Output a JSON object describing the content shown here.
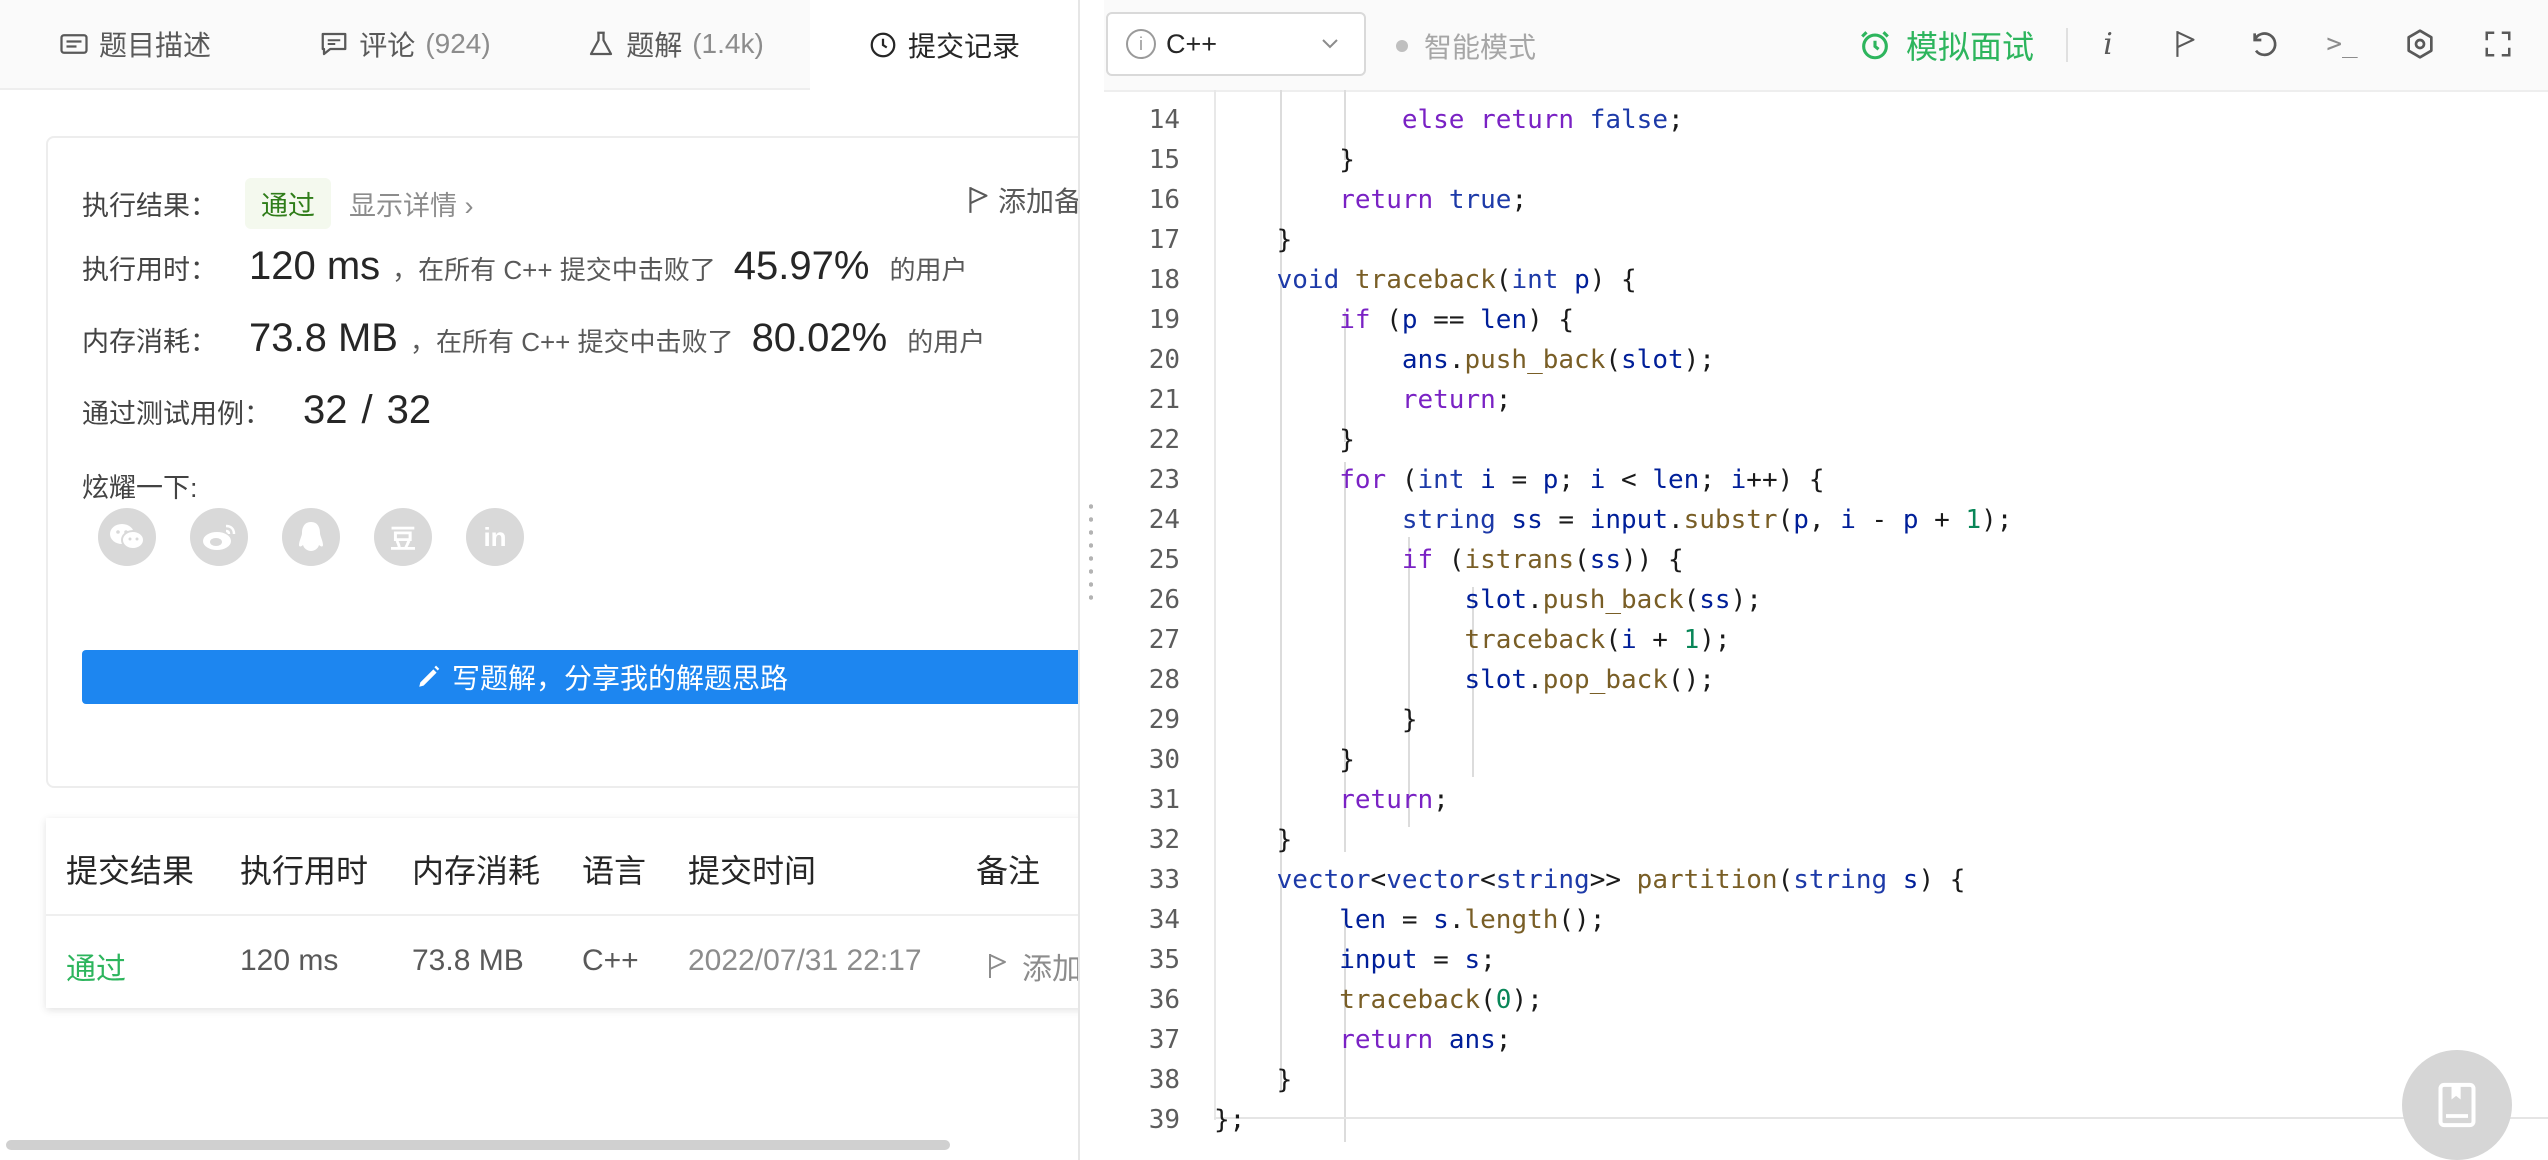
{
  "tabs": [
    {
      "label": "题目描述",
      "count": ""
    },
    {
      "label": "评论",
      "count": "(924)"
    },
    {
      "label": "题解",
      "count": "(1.4k)"
    },
    {
      "label": "提交记录",
      "count": ""
    }
  ],
  "result": {
    "exec_result_label": "执行结果：",
    "status": "通过",
    "details_link": "显示详情",
    "add_note": "添加备",
    "time_label": "执行用时：",
    "time_value": "120 ms",
    "time_mid": "，在所有 C++ 提交中击败了",
    "time_pct": "45.97%",
    "users_suffix": "的用户",
    "mem_label": "内存消耗：",
    "mem_value": "73.8 MB",
    "mem_mid": "，在所有 C++ 提交中击败了",
    "mem_pct": "80.02%",
    "tests_label": "通过测试用例：",
    "tests_value": "32",
    "tests_sep": "/",
    "tests_total": "32",
    "share_label": "炫耀一下:",
    "share_icons": [
      "wechat-icon",
      "weibo-icon",
      "qq-icon",
      "douban-icon",
      "linkedin-icon"
    ],
    "douban_glyph": "豆",
    "linkedin_glyph": "in",
    "write_solution": "写题解，分享我的解题思路"
  },
  "submissions": {
    "headers": [
      "提交结果",
      "执行用时",
      "内存消耗",
      "语言",
      "提交时间",
      "备注"
    ],
    "rows": [
      {
        "result": "通过",
        "time": "120 ms",
        "memory": "73.8 MB",
        "lang": "C++",
        "submitted": "2022/07/31 22:17",
        "note": "添加"
      }
    ]
  },
  "editor": {
    "language": "C++",
    "info_glyph": "i",
    "smart_mode": "智能模式",
    "mock_interview": "模拟面试",
    "info_label": "i",
    "terminal_label": ">_",
    "visible_line_numbers": [
      14,
      15,
      16,
      17,
      18,
      19,
      20,
      21,
      22,
      23,
      24,
      25,
      26,
      27,
      28,
      29,
      30,
      31,
      32,
      33,
      34,
      35,
      36,
      37,
      38,
      39
    ]
  },
  "colors": {
    "accent_green": "#2db55d",
    "button_blue": "#1d86f0",
    "pass_badge_bg": "#f4f9ee"
  }
}
